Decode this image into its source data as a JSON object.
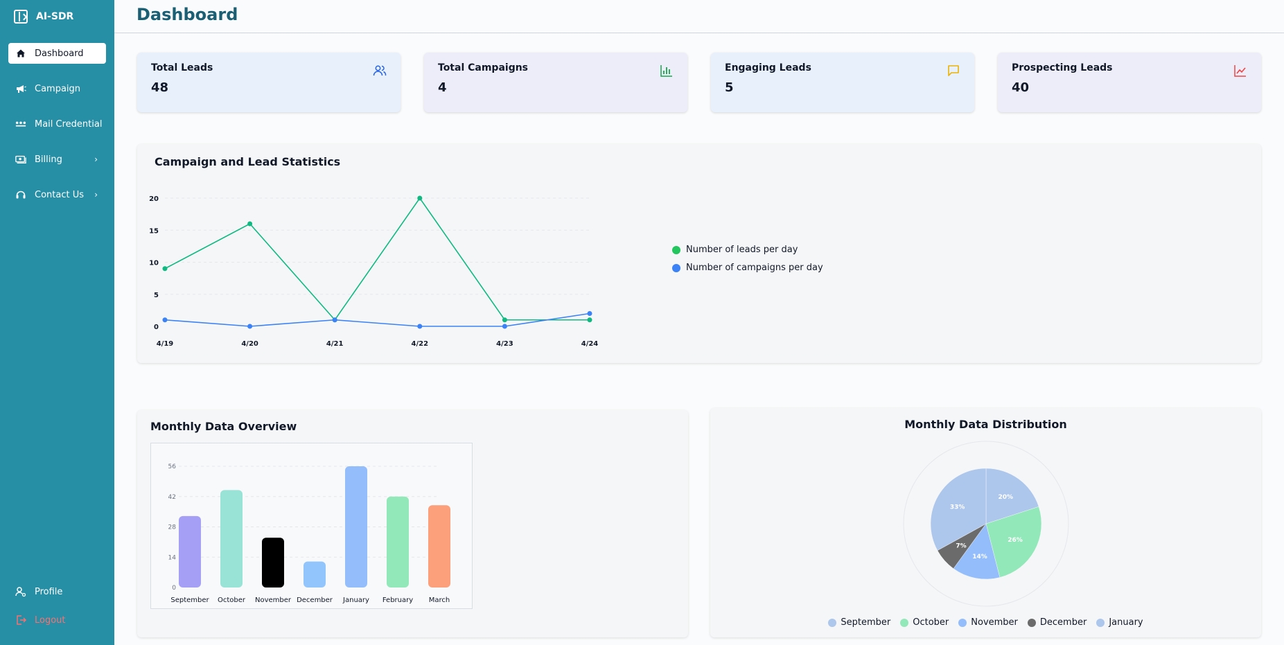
{
  "app": {
    "name": "AI-SDR"
  },
  "sidebar": {
    "items": [
      {
        "label": "Dashboard",
        "icon": "home-icon"
      },
      {
        "label": "Campaign",
        "icon": "megaphone-icon"
      },
      {
        "label": "Mail Credential",
        "icon": "dots-icon"
      },
      {
        "label": "Billing",
        "icon": "money-icon"
      },
      {
        "label": "Contact Us",
        "icon": "headset-icon"
      }
    ],
    "profile_label": "Profile",
    "logout_label": "Logout"
  },
  "header": {
    "title": "Dashboard"
  },
  "stats": [
    {
      "label": "Total Leads",
      "value": "48",
      "icon": "users-icon",
      "color": "#2563eb"
    },
    {
      "label": "Total Campaigns",
      "value": "4",
      "icon": "bar-chart-icon",
      "color": "#16a34a"
    },
    {
      "label": "Engaging Leads",
      "value": "5",
      "icon": "message-icon",
      "color": "#eab308"
    },
    {
      "label": "Prospecting Leads",
      "value": "40",
      "icon": "trend-icon",
      "color": "#ef4444"
    }
  ],
  "line_panel": {
    "title": "Campaign and Lead Statistics"
  },
  "bar_panel": {
    "title": "Monthly Data Overview"
  },
  "pie_panel": {
    "title": "Monthly Data Distribution"
  },
  "chart_data": [
    {
      "type": "line",
      "title": "Campaign and Lead Statistics",
      "x": [
        "4/19",
        "4/20",
        "4/21",
        "4/22",
        "4/23",
        "4/24"
      ],
      "yticks": [
        0,
        5,
        10,
        15,
        20
      ],
      "ylim": [
        0,
        20
      ],
      "grid": true,
      "legend": "right",
      "series": [
        {
          "name": "Number of leads per day",
          "values": [
            9,
            16,
            1,
            20,
            1,
            1
          ],
          "color": "#10b981"
        },
        {
          "name": "Number of campaigns per day",
          "values": [
            1,
            0,
            1,
            0,
            0,
            2
          ],
          "color": "#3b82f6"
        }
      ]
    },
    {
      "type": "bar",
      "title": "Monthly Data Overview",
      "categories": [
        "September",
        "October",
        "November",
        "December",
        "January",
        "February",
        "March"
      ],
      "values": [
        33,
        45,
        23,
        12,
        56,
        42,
        38
      ],
      "colors": [
        "#a5a0f5",
        "#99e2d6",
        "#000000",
        "#93c5fd",
        "#93bdfb",
        "#92e8b8",
        "#fba07a"
      ],
      "yticks": [
        0,
        14,
        28,
        42,
        56
      ],
      "ylim": [
        0,
        56
      ],
      "grid": true
    },
    {
      "type": "pie",
      "title": "Monthly Data Distribution",
      "slices": [
        {
          "label": "September",
          "value": 33,
          "color": "#adc6ec"
        },
        {
          "label": "October",
          "value": 26,
          "color": "#92e8b8"
        },
        {
          "label": "November",
          "value": 14,
          "color": "#93bdfb"
        },
        {
          "label": "December",
          "value": 7,
          "color": "#6b6b6b"
        },
        {
          "label": "January",
          "value": 20,
          "color": "#adc6ec"
        }
      ],
      "slice_labels": [
        "20%",
        "26%",
        "14%",
        "7%",
        "33%"
      ],
      "legend": "bottom"
    }
  ]
}
